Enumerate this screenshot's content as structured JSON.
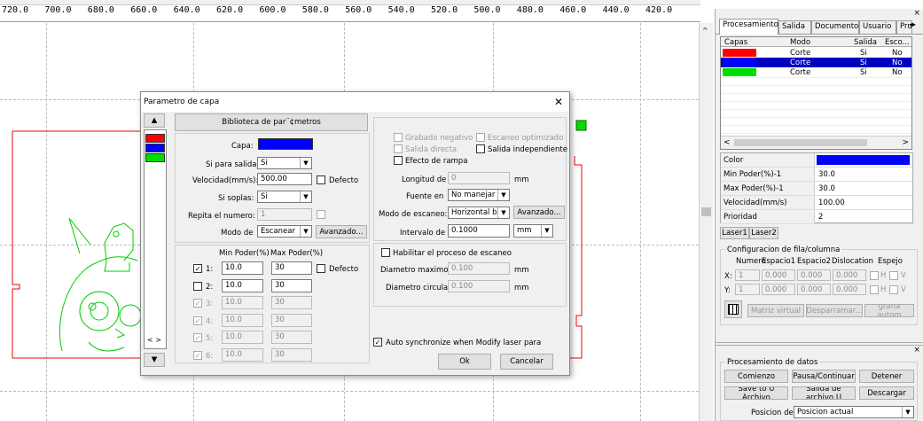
{
  "ruler": {
    "ticks": [
      "720.0",
      "700.0",
      "680.0",
      "660.0",
      "640.0",
      "620.0",
      "600.0",
      "580.0",
      "560.0",
      "540.0",
      "520.0",
      "500.0",
      "480.0",
      "460.0",
      "440.0",
      "420.0"
    ]
  },
  "right_panel": {
    "tabs": [
      "Procesamiento",
      "Salida",
      "Documento",
      "Usuario",
      "Pru"
    ],
    "layers_table": {
      "headers": [
        "Capas",
        "Modo",
        "Salida",
        "Esco..."
      ],
      "rows": [
        {
          "color": "#ff0000",
          "modo": "Corte",
          "salida": "Si",
          "esco": "No"
        },
        {
          "color": "#0000ff",
          "modo": "Corte",
          "salida": "Si",
          "esco": "No"
        },
        {
          "color": "#00dd00",
          "modo": "Corte",
          "salida": "Si",
          "esco": "No"
        }
      ]
    },
    "props": [
      {
        "label": "Color",
        "value": ""
      },
      {
        "label": "Min Poder(%)-1",
        "value": "30.0"
      },
      {
        "label": "Max Poder(%)-1",
        "value": "30.0"
      },
      {
        "label": "Velocidad(mm/s)",
        "value": "100.00"
      },
      {
        "label": "Prioridad",
        "value": "2"
      }
    ],
    "color_value": "#0000ff",
    "laser_buttons": [
      "Laser1",
      "Laser2"
    ],
    "row_col": {
      "title": "Configuracion de fila/columna",
      "headers": [
        "Numero",
        "Espacio1",
        "Espacio2",
        "Dislocation",
        "Espejo"
      ],
      "x_label": "X:",
      "y_label": "Y:",
      "x_values": [
        "1",
        "0.000",
        "0.000",
        "0.000"
      ],
      "y_values": [
        "1",
        "0.000",
        "0.000",
        "0.000"
      ],
      "mirror_h": "H",
      "mirror_v": "V",
      "buttons": [
        "Matriz virtual",
        "Desparramar...",
        "grafia autom"
      ]
    },
    "data_processing": {
      "title": "Procesamiento de datos",
      "buttons": [
        "Comienzo",
        "Pausa/Continuar",
        "Detener",
        "Save to U Archivo",
        "Salida de archivo U",
        "Descargar"
      ],
      "position_label": "Posicion de",
      "position_value": "Posicion actual"
    }
  },
  "dialog": {
    "title": "Parametro de capa",
    "close": "✕",
    "library_button": "Biblioteca de par¨¢metros",
    "capa_label": "Capa:",
    "capa_color": "#0000ff",
    "output_label": "Si para salida:",
    "output_value": "Si",
    "speed_label": "Velocidad(mm/s):",
    "speed_value": "500.00",
    "speed_default": "Defecto",
    "blow_label": "Si soplas:",
    "blow_value": "Si",
    "repeat_label": "Repita el numero:",
    "repeat_value": "1",
    "mode_label": "Modo de",
    "mode_value": "Escanear",
    "advanced_button": "Avanzado...",
    "power_headers": [
      "Min Poder(%)",
      "Max Poder(%)"
    ],
    "power_rows": [
      {
        "idx": "1:",
        "min": "10.0",
        "max": "30",
        "checked": true,
        "enabled": true
      },
      {
        "idx": "2:",
        "min": "10.0",
        "max": "30",
        "checked": false,
        "enabled": true
      },
      {
        "idx": "3:",
        "min": "10.0",
        "max": "30",
        "checked": true,
        "enabled": false
      },
      {
        "idx": "4:",
        "min": "10.0",
        "max": "30",
        "checked": true,
        "enabled": false
      },
      {
        "idx": "5:",
        "min": "10.0",
        "max": "30",
        "checked": true,
        "enabled": false
      },
      {
        "idx": "6:",
        "min": "10.0",
        "max": "30",
        "checked": true,
        "enabled": false
      }
    ],
    "power_default": "Defecto",
    "left_list_colors": [
      "#ff0000",
      "#0000ff",
      "#00dd00"
    ],
    "scan": {
      "neg_engrave": "Grabado negativo",
      "optimized_scan": "Escaneo optimizado",
      "direct_output": "Salida directa",
      "independent_output": "Salida independiente",
      "ramp_effect": "Efecto de rampa",
      "length_label": "Longitud de",
      "length_value": "0",
      "length_unit": "mm",
      "source_label": "Fuente en",
      "source_value": "No manejar",
      "scan_mode_label": "Modo de escaneo:",
      "scan_mode_value": "Horizontal bidi",
      "scan_advanced": "Avanzado...",
      "interval_label": "Intervalo de",
      "interval_value": "0.1000",
      "interval_unit": "mm"
    },
    "hole": {
      "enable_label": "Habilitar el proceso de escaneo",
      "max_diam_label": "Diametro maximo:",
      "max_diam_value": "0.100",
      "circ_diam_label": "Diametro circular",
      "circ_diam_value": "0.100",
      "unit": "mm"
    },
    "auto_sync": "Auto synchronize when Modify laser para",
    "ok": "Ok",
    "cancel": "Cancelar",
    "nav": "< >"
  }
}
